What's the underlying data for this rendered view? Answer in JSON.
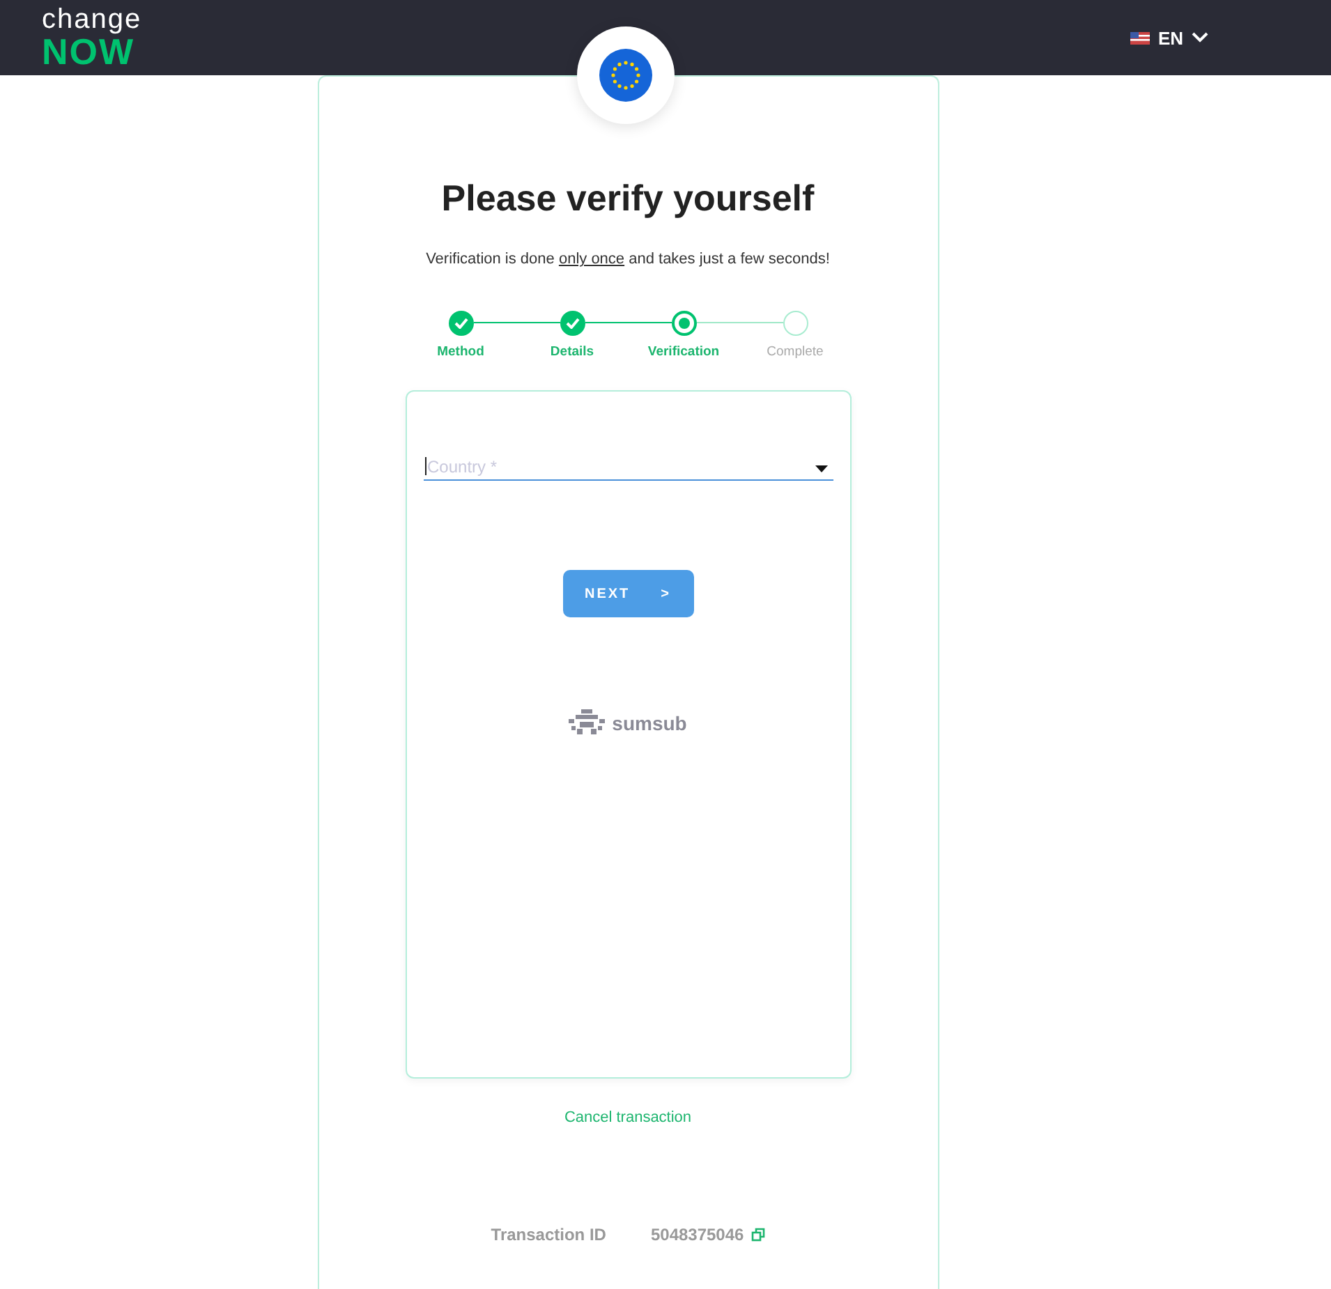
{
  "header": {
    "logo_top": "change",
    "logo_bottom": "NOW",
    "language": "EN"
  },
  "title": "Please verify yourself",
  "subtitle": {
    "before": "Verification is done ",
    "link": "only once",
    "after": " and takes just a few seconds!"
  },
  "steps": [
    {
      "label": "Method",
      "kind": "done"
    },
    {
      "label": "Details",
      "kind": "done"
    },
    {
      "label": "Verification",
      "kind": "current"
    },
    {
      "label": "Complete",
      "kind": "pending"
    }
  ],
  "country_field": {
    "placeholder": "Country *"
  },
  "next_button": {
    "label": "NEXT",
    "arrow": ">"
  },
  "provider": "sumsub",
  "cancel_link": "Cancel transaction",
  "transaction": {
    "label": "Transaction ID",
    "value": "5048375046"
  }
}
